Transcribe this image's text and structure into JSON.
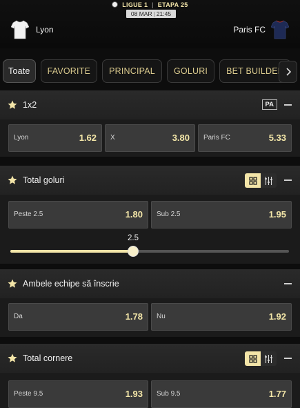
{
  "header": {
    "league": "LIGUE 1",
    "stage_label": "ETAPA",
    "stage_number": "25",
    "date": "08 MAR",
    "time": "21:45",
    "home_team": "Lyon",
    "away_team": "Paris FC",
    "home_jersey_color": "#f2f2f2",
    "away_jersey_color": "#1e2a55"
  },
  "tabs": [
    "Toate",
    "FAVORITE",
    "PRINCIPAL",
    "GOLURI",
    "BET BUILDER"
  ],
  "active_tab": "Toate",
  "colors": {
    "accent": "#f3e5a8",
    "odd_value": "#f3e6a8"
  },
  "markets": {
    "m1x2": {
      "title": "1x2",
      "badge": "PA",
      "odds": [
        {
          "label": "Lyon",
          "value": "1.62"
        },
        {
          "label": "X",
          "value": "3.80"
        },
        {
          "label": "Paris FC",
          "value": "5.33"
        }
      ]
    },
    "goals": {
      "title": "Total goluri",
      "odds": [
        {
          "label": "Peste 2.5",
          "value": "1.80"
        },
        {
          "label": "Sub 2.5",
          "value": "1.95"
        }
      ],
      "slider_value": "2.5",
      "slider_fraction": 0.44
    },
    "btts": {
      "title": "Ambele echipe să înscrie",
      "odds": [
        {
          "label": "Da",
          "value": "1.78"
        },
        {
          "label": "Nu",
          "value": "1.92"
        }
      ]
    },
    "corners": {
      "title": "Total cornere",
      "odds": [
        {
          "label": "Peste 9.5",
          "value": "1.93"
        },
        {
          "label": "Sub 9.5",
          "value": "1.77"
        }
      ]
    }
  }
}
